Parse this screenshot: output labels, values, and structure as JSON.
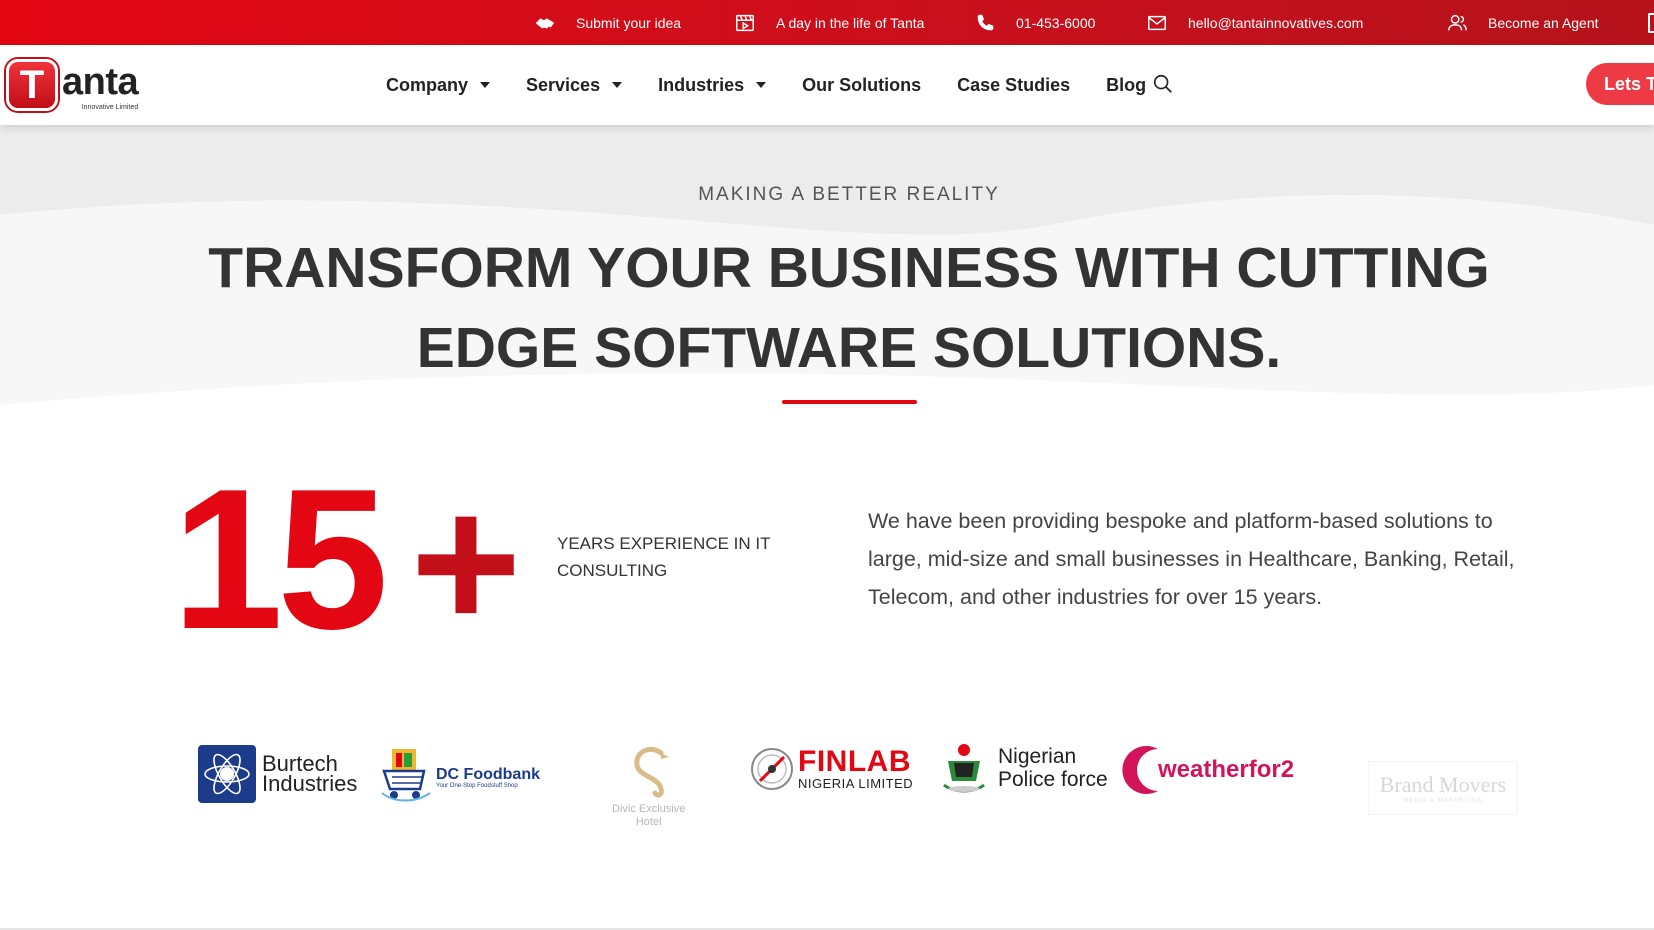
{
  "topbar": {
    "submit_idea": "Submit your idea",
    "day_in_life": "A day in the life of Tanta",
    "phone": "01-453-6000",
    "email": "hello@tantainnovatives.com",
    "become_agent": "Become an Agent",
    "background_color": "#e30613"
  },
  "header": {
    "logo_letter": "T",
    "logo_word": "anta",
    "logo_tagline": "Innovative Limited",
    "nav": {
      "company": "Company",
      "services": "Services",
      "industries": "Industries",
      "solutions": "Our Solutions",
      "case_studies": "Case Studies",
      "blog": "Blog"
    },
    "cta_label": "Lets Ta",
    "accent_color": "#ee3a44"
  },
  "hero": {
    "eyebrow": "MAKING A BETTER REALITY",
    "headline_line1": "TRANSFORM YOUR BUSINESS WITH CUTTING",
    "headline_line2": "EDGE SOFTWARE SOLUTIONS."
  },
  "stats": {
    "number": "15",
    "plus": "+",
    "label_line1": "YEARS EXPERIENCE IN IT",
    "label_line2": "CONSULTING",
    "description": "We have been providing bespoke and platform-based solutions to large, mid-size and small businesses in Healthcare, Banking, Retail, Telecom, and other industries for over 15 years.",
    "number_color": "#e30613"
  },
  "clients": {
    "burtech_line1": "Burtech",
    "burtech_line2": "Industries",
    "dc_foodbank": "DC Foodbank",
    "dc_foodbank_tag": "Your One-Stop Foodstuff Shop",
    "divic_line1": "Divic Exclusive",
    "divic_line2": "Hotel",
    "finlab": "FINLAB",
    "finlab_sub": "NIGERIA LIMITED",
    "police_line1": "Nigerian",
    "police_line2": "Police force",
    "weather": "weatherfor2",
    "brand_movers": "Brand Movers",
    "brand_movers_tag": "MEDIA & MARKETING"
  }
}
